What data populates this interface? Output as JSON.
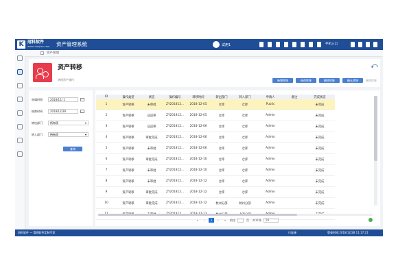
{
  "app": {
    "brand": "冠科软件",
    "brand_url": "www.ruanjian.com",
    "system_title": "资产管理系统",
    "user_name": "试用1",
    "user_label": "手机入口"
  },
  "breadcrumb": {
    "text": "资产管理"
  },
  "page": {
    "title": "资产转移",
    "subtitle": "转移资产操作",
    "buttons": [
      "新增转移",
      "修改转移",
      "删除转移",
      "确认转移"
    ],
    "disabled_button": "撤销转移"
  },
  "filters": {
    "apply_date_label": "申请时间",
    "apply_date_value": "2018/12/ 1",
    "end_date_label": "结束时间",
    "end_date_value": "2018/12/28",
    "from_dept_label": "转出部门",
    "from_dept_value": "所有项",
    "to_dept_label": "转入部门",
    "to_dept_value": "所有项",
    "query_button": "查询"
  },
  "table": {
    "columns": [
      "ID",
      "操作类型",
      "状态",
      "操作编号",
      "转移时间",
      "转出部门",
      "转入部门",
      "申请人",
      "备注",
      "完成状态"
    ],
    "rows": [
      [
        "1",
        "资产转移",
        "未审批",
        "ZY201812...",
        "2018-12-05",
        "仓库",
        "仓库",
        "Public",
        "",
        "未完成"
      ],
      [
        "2",
        "资产转移",
        "已还审",
        "ZY201812...",
        "2018-12-05",
        "仓库",
        "仓库",
        "Admin",
        "",
        "未完成"
      ],
      [
        "3",
        "资产转移",
        "已还审",
        "ZY201812...",
        "2018-12-06",
        "仓库",
        "仓库",
        "Admin",
        "",
        "未完成"
      ],
      [
        "4",
        "资产转移",
        "审批完成",
        "ZY201812...",
        "2018-12-06",
        "仓库",
        "仓库",
        "Admin",
        "",
        "未完成"
      ],
      [
        "5",
        "资产转移",
        "未审批",
        "ZY201812...",
        "2018-12-06",
        "仓库",
        "仓库",
        "Admin",
        "",
        "未完成"
      ],
      [
        "6",
        "资产转移",
        "审批完成",
        "ZY201812...",
        "2018-12-10",
        "仓库",
        "仓库",
        "Admin",
        "",
        "未完成"
      ],
      [
        "7",
        "资产转移",
        "未审批",
        "ZY201812...",
        "2018-12-10",
        "仓库",
        "仓库",
        "Admin",
        "",
        "未完成"
      ],
      [
        "8",
        "资产转移",
        "未审批",
        "ZY201812...",
        "2018-12-12",
        "仓库",
        "仓库",
        "Admin",
        "",
        "未完成"
      ],
      [
        "9",
        "资产转移",
        "审批完成",
        "ZY201812...",
        "2018-12-12",
        "仓库",
        "仓库",
        "Admin",
        "",
        "未完成"
      ],
      [
        "10",
        "资产转移",
        "审批完成",
        "ZY201812...",
        "2018-12-12",
        "杭州分部",
        "杭州分部",
        "Admin",
        "",
        "未完成"
      ],
      [
        "11",
        "资产转移",
        "未审批",
        "ZY201812...",
        "2018-12-13",
        "杭州分部",
        "上海分部",
        "Admin",
        "",
        "未完成"
      ]
    ]
  },
  "pager": {
    "first": "«",
    "prev": "‹",
    "current": "1",
    "next": "›",
    "last": "»",
    "goto": "前往",
    "unit": "页",
    "total": "共11条",
    "page_size": "20"
  },
  "status": {
    "left": "冠科软件 — 管理软件定制专家",
    "middle": "已连接",
    "right": "登录时间:2018/12/28 11:17:21"
  },
  "colors": {
    "primary": "#1f4e96",
    "accent": "#4a7fd1",
    "selected_row": "#fdf3bf",
    "alert_icon": "#e83b4c"
  }
}
